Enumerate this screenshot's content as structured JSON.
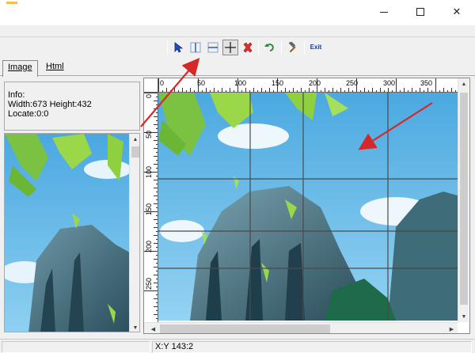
{
  "window": {
    "min_icon": "minimize-icon",
    "max_icon": "maximize-icon",
    "close_glyph": "✕"
  },
  "toolbar": {
    "items": [
      {
        "name": "pointer-icon"
      },
      {
        "name": "vertical-split-icon"
      },
      {
        "name": "horizontal-split-icon"
      },
      {
        "name": "cross-split-icon"
      },
      {
        "name": "delete-icon"
      },
      {
        "name": "undo-icon"
      },
      {
        "name": "hammer-icon"
      },
      {
        "name": "exit-icon",
        "label": "Exit"
      }
    ]
  },
  "tabs": [
    {
      "label": "Image"
    },
    {
      "label": "Html"
    }
  ],
  "info": {
    "title": "Info:",
    "size": "Width:673 Height:432",
    "locate": "Locate:0:0"
  },
  "ruler": {
    "top_labels": [
      "0",
      "50",
      "100",
      "150",
      "200",
      "250",
      "300",
      "350"
    ],
    "left_labels": [
      "0",
      "50",
      "100",
      "150",
      "200",
      "250"
    ]
  },
  "status": {
    "coords": "X:Y 143:2"
  },
  "colors": {
    "sky": "#5fb6e6",
    "grid_line": "#555555",
    "annotation_arrow": "#d62828",
    "rock": "#3e6a7a",
    "leaf": "#8fd13f"
  }
}
